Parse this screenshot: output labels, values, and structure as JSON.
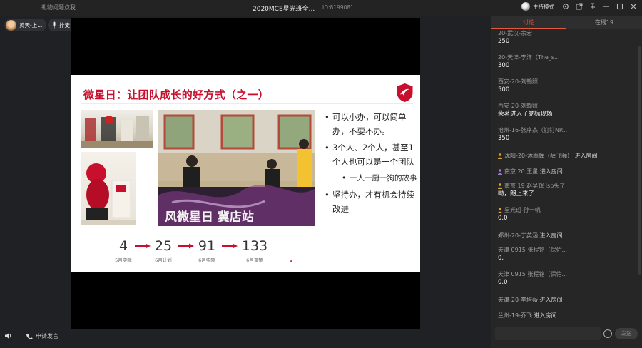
{
  "topbar": {
    "left_text": "礼物问题点我",
    "title": "2020MCE星光班全...",
    "room_id": "ID:8199081",
    "host_mode_label": "主持模式"
  },
  "left": {
    "badge1_text": "黄天-上...",
    "badge2_text": "排麦",
    "audio_label": "",
    "apply_speak_label": "申请发言"
  },
  "slide": {
    "title": "微星日：让团队成长的好方式（之一）",
    "bullets": [
      "可以小办，可以简单办，不要不办。",
      "3个人、2个人，甚至1个人也可以是一个团队",
      "坚持办，才有机会持续改进"
    ],
    "sub_bullet": "一人一厨一狗的故事",
    "photo_banner_text": "风微星日 冀店站",
    "timeline": [
      {
        "value": "4",
        "label": "5月实际"
      },
      {
        "value": "25",
        "label": "6月计划"
      },
      {
        "value": "91",
        "label": "6月实际"
      },
      {
        "value": "133",
        "label": "6月调整"
      }
    ]
  },
  "right": {
    "tabs": [
      "讨论",
      "在线19"
    ],
    "messages": [
      {
        "name": "20-武汉-余宏",
        "text": "250"
      },
      {
        "name": "20-天津-李洋（The_s...",
        "text": "300"
      },
      {
        "name": "西安-20-刘翰照",
        "text": "500"
      },
      {
        "name": "西安-20-刘翰照",
        "text": "荣茗进入了党标现场"
      },
      {
        "name": "沧州-16-张序杰（钉钉NP...",
        "text": "350"
      }
    ],
    "sys_lines": [
      {
        "name": "沈阳-20-沐雨辉（薛飞骊）",
        "action": "进入房间"
      },
      {
        "name": "南京  20   王星",
        "action": "进入房间"
      }
    ],
    "messages2": [
      {
        "name": "南京 19 赵吴辉 lsp头了",
        "text": "呦，朗上来了"
      },
      {
        "name": "星光班-孙一帆",
        "text": "0.0"
      }
    ],
    "sys_lines2": [
      {
        "name": "郑州-20-丁英涵",
        "action": "进入房间"
      }
    ],
    "messages3": [
      {
        "name": "天津 0915 张程铭（保佑...",
        "text": "0."
      },
      {
        "name": "天津 0915 张程铭（保佑...",
        "text": "0.0"
      }
    ],
    "sys_lines3": [
      {
        "name": "天津-20-李培薇",
        "action": "进入房间"
      },
      {
        "name": "兰州-19-乔飞",
        "action": "进入房间"
      }
    ],
    "send_label": "发送",
    "input_placeholder": ""
  },
  "colors": {
    "accent": "#e05a3c",
    "slide_title": "#c8102e"
  }
}
